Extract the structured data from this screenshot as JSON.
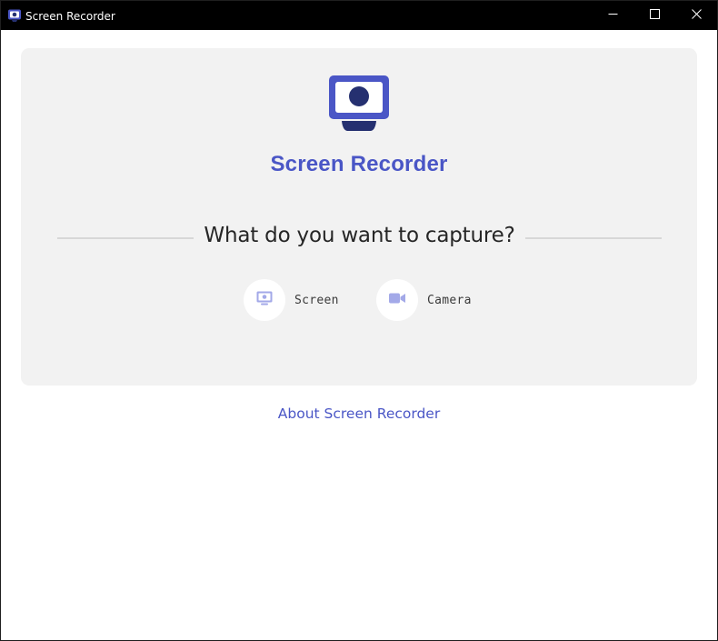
{
  "window": {
    "title": "Screen Recorder",
    "icon": "monitor-record-icon",
    "controls": [
      "minimize-icon",
      "maximize-icon",
      "close-icon"
    ]
  },
  "app": {
    "logo_icon": "monitor-record-icon",
    "title": "Screen Recorder",
    "question": "What do you want to capture?",
    "options": [
      {
        "label": "Screen",
        "icon": "screen-icon"
      },
      {
        "label": "Camera",
        "icon": "video-camera-icon"
      }
    ],
    "about_link": "About Screen Recorder"
  },
  "colors": {
    "accent": "#4a56c6",
    "accent_dark": "#253070",
    "option_icon": "#a3a9e8",
    "card_background": "#f2f2f2",
    "titlebar": "#000000"
  }
}
